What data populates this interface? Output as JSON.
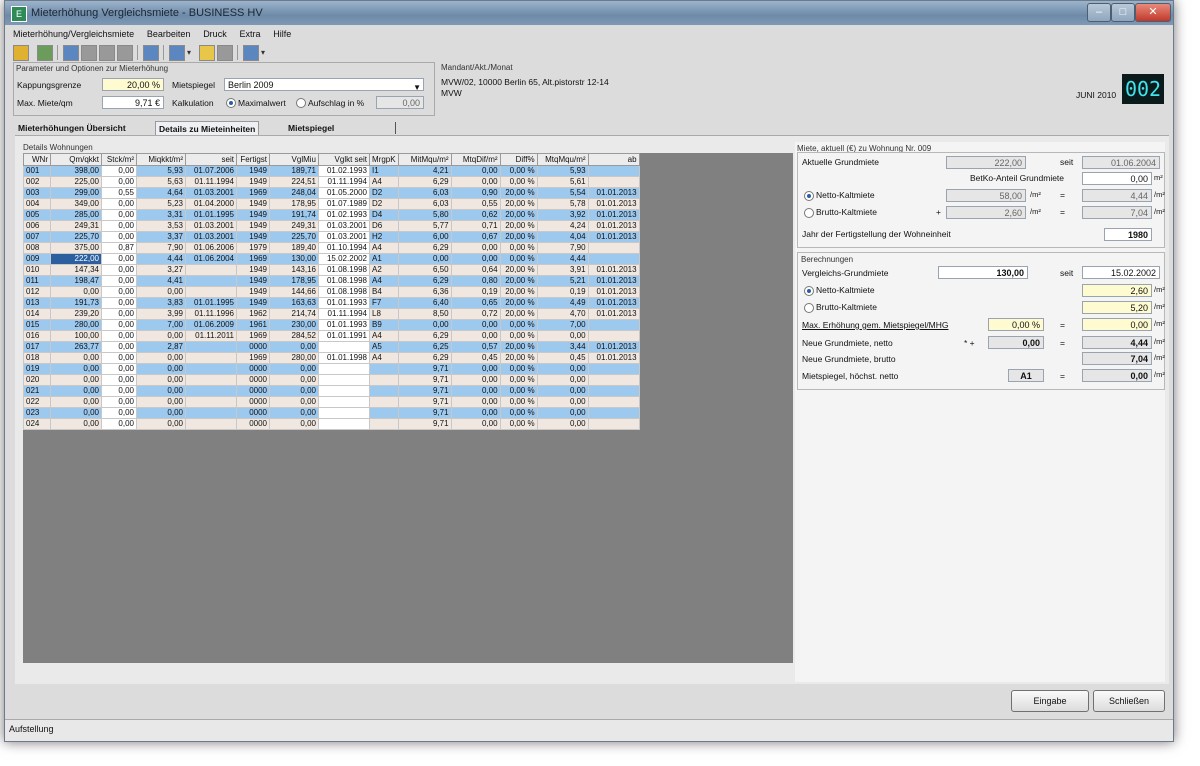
{
  "window": {
    "title": "Mieterhöhung Vergleichsmiete - BUSINESS HV"
  },
  "menu": [
    "Mieterhöhung/Vergleichsmiete",
    "Bearbeiten",
    "Druck",
    "Extra",
    "Hilfe"
  ],
  "params": {
    "group_title": "Parameter und Optionen zur Mieterhöhung",
    "kappung_label": "Kappungsgrenze",
    "kappung_value": "20,00 %",
    "maxmiete_label": "Max. Miete/qm",
    "maxmiete_value": "9,71 €",
    "mietspiegel_label": "Mietspiegel",
    "mietspiegel_value": "Berlin 2009",
    "kalkulation_label": "Kalkulation",
    "maximalwert_label": "Maximalwert",
    "aufschlag_label": "Aufschlag in %",
    "aufschlag_value": "0,00"
  },
  "mandant": {
    "title": "Mandant/Akt./Monat",
    "line1": "MVW/02, 10000 Berlin 65, Alt.pistorstr 12-14",
    "line2": "MVW",
    "month": "JUNI 2010",
    "badge": "002"
  },
  "tabs": [
    "Mieterhöhungen Übersicht",
    "Details zu Mieteinheiten",
    "Mietspiegel"
  ],
  "details": {
    "title": "Details Wohnungen",
    "headers": [
      "WNr",
      "Qm/qkkt",
      "Stck/m²",
      "Miqkkt/m²",
      "seit",
      "Fertigst",
      "VglMiu",
      "Vglkt seit",
      "MrgpK",
      "MitMqu/m²",
      "MtqDif/m²",
      "Diff%",
      "MtqMqu/m²",
      "ab"
    ],
    "rows": [
      {
        "c": [
          "001",
          "398,00",
          "0,00",
          "5,93",
          "01.07.2006",
          "1949",
          "189,71",
          "01.02.1993",
          "I1",
          "4,21",
          "0,00",
          "0,00 %",
          "5,93",
          ""
        ],
        "cls": "blue"
      },
      {
        "c": [
          "002",
          "225,00",
          "0,00",
          "5,63",
          "01.11.1994",
          "1949",
          "224,51",
          "01.11.1994",
          "A4",
          "6,29",
          "0,00",
          "0,00 %",
          "5,61",
          ""
        ],
        "cls": "beige"
      },
      {
        "c": [
          "003",
          "299,00",
          "0,55",
          "4,64",
          "01.03.2001",
          "1969",
          "248,04",
          "01.05.2000",
          "D2",
          "6,03",
          "0,90",
          "20,00 %",
          "5,54",
          "01.01.2013"
        ],
        "cls": "blue"
      },
      {
        "c": [
          "004",
          "349,00",
          "0,00",
          "5,23",
          "01.04.2000",
          "1949",
          "178,95",
          "01.07.1989",
          "D2",
          "6,03",
          "0,55",
          "20,00 %",
          "5,78",
          "01.01.2013"
        ],
        "cls": "beige"
      },
      {
        "c": [
          "005",
          "285,00",
          "0,00",
          "3,31",
          "01.01.1995",
          "1949",
          "191,74",
          "01.02.1993",
          "D4",
          "5,80",
          "0,62",
          "20,00 %",
          "3,92",
          "01.01.2013"
        ],
        "cls": "blue"
      },
      {
        "c": [
          "006",
          "249,31",
          "0,00",
          "3,53",
          "01.03.2001",
          "1949",
          "249,31",
          "01.03.2001",
          "D6",
          "5,77",
          "0,71",
          "20,00 %",
          "4,24",
          "01.01.2013"
        ],
        "cls": "beige"
      },
      {
        "c": [
          "007",
          "225,70",
          "0,00",
          "3,37",
          "01.03.2001",
          "1949",
          "225,70",
          "01.03.2001",
          "H2",
          "6,00",
          "0,67",
          "20,00 %",
          "4,04",
          "01.01.2013"
        ],
        "cls": "blue"
      },
      {
        "c": [
          "008",
          "375,00",
          "0,87",
          "7,90",
          "01.06.2006",
          "1979",
          "189,40",
          "01.10.1994",
          "A4",
          "6,29",
          "0,00",
          "0,00 %",
          "7,90",
          ""
        ],
        "cls": "beige"
      },
      {
        "c": [
          "009",
          "222,00",
          "0,00",
          "4,44",
          "01.06.2004",
          "1969",
          "130,00",
          "15.02.2002",
          "A1",
          "0,00",
          "0,00",
          "0,00 %",
          "4,44",
          ""
        ],
        "cls": "blue"
      },
      {
        "c": [
          "010",
          "147,34",
          "0,00",
          "3,27",
          "",
          "1949",
          "143,16",
          "01.08.1998",
          "A2",
          "6,50",
          "0,64",
          "20,00 %",
          "3,91",
          "01.01.2013"
        ],
        "cls": "beige"
      },
      {
        "c": [
          "011",
          "198,47",
          "0,00",
          "4,41",
          "",
          "1949",
          "178,95",
          "01.08.1998",
          "A4",
          "6,29",
          "0,80",
          "20,00 %",
          "5,21",
          "01.01.2013"
        ],
        "cls": "blue"
      },
      {
        "c": [
          "012",
          "0,00",
          "0,00",
          "0,00",
          "",
          "1949",
          "144,66",
          "01.08.1998",
          "B4",
          "6,36",
          "0,19",
          "20,00 %",
          "0,19",
          "01.01.2013"
        ],
        "cls": "beige"
      },
      {
        "c": [
          "013",
          "191,73",
          "0,00",
          "3,83",
          "01.01.1995",
          "1949",
          "163,63",
          "01.01.1993",
          "F7",
          "6,40",
          "0,65",
          "20,00 %",
          "4,49",
          "01.01.2013"
        ],
        "cls": "blue"
      },
      {
        "c": [
          "014",
          "239,20",
          "0,00",
          "3,99",
          "01.11.1996",
          "1962",
          "214,74",
          "01.11.1994",
          "L8",
          "8,50",
          "0,72",
          "20,00 %",
          "4,70",
          "01.01.2013"
        ],
        "cls": "beige"
      },
      {
        "c": [
          "015",
          "280,00",
          "0,00",
          "7,00",
          "01.06.2009",
          "1961",
          "230,00",
          "01.01.1993",
          "B9",
          "0,00",
          "0,00",
          "0,00 %",
          "7,00",
          ""
        ],
        "cls": "blue"
      },
      {
        "c": [
          "016",
          "100,00",
          "0,00",
          "0,00",
          "01.11.2011",
          "1969",
          "284,52",
          "01.01.1991",
          "A4",
          "6,29",
          "0,00",
          "0,00 %",
          "0,00",
          ""
        ],
        "cls": "beige"
      },
      {
        "c": [
          "017",
          "263,77",
          "0,00",
          "2,87",
          "",
          "0000",
          "0,00",
          "",
          "A5",
          "6,25",
          "0,57",
          "20,00 %",
          "3,44",
          "01.01.2013"
        ],
        "cls": "blue"
      },
      {
        "c": [
          "018",
          "0,00",
          "0,00",
          "0,00",
          "",
          "1969",
          "280,00",
          "01.01.1998",
          "A4",
          "6,29",
          "0,45",
          "20,00 %",
          "0,45",
          "01.01.2013"
        ],
        "cls": "beige"
      },
      {
        "c": [
          "019",
          "0,00",
          "0,00",
          "0,00",
          "",
          "0000",
          "0,00",
          "",
          "",
          "9,71",
          "0,00",
          "0,00 %",
          "0,00",
          ""
        ],
        "cls": "blue"
      },
      {
        "c": [
          "020",
          "0,00",
          "0,00",
          "0,00",
          "",
          "0000",
          "0,00",
          "",
          "",
          "9,71",
          "0,00",
          "0,00 %",
          "0,00",
          ""
        ],
        "cls": "beige"
      },
      {
        "c": [
          "021",
          "0,00",
          "0,00",
          "0,00",
          "",
          "0000",
          "0,00",
          "",
          "",
          "9,71",
          "0,00",
          "0,00 %",
          "0,00",
          ""
        ],
        "cls": "blue"
      },
      {
        "c": [
          "022",
          "0,00",
          "0,00",
          "0,00",
          "",
          "0000",
          "0,00",
          "",
          "",
          "9,71",
          "0,00",
          "0,00 %",
          "0,00",
          ""
        ],
        "cls": "beige"
      },
      {
        "c": [
          "023",
          "0,00",
          "0,00",
          "0,00",
          "",
          "0000",
          "0,00",
          "",
          "",
          "9,71",
          "0,00",
          "0,00 %",
          "0,00",
          ""
        ],
        "cls": "blue"
      },
      {
        "c": [
          "024",
          "0,00",
          "0,00",
          "0,00",
          "",
          "0000",
          "0,00",
          "",
          "",
          "9,71",
          "0,00",
          "0,00 %",
          "0,00",
          ""
        ],
        "cls": "beige"
      }
    ]
  },
  "right": {
    "header": "Miete, aktuell (€) zu Wohnung Nr. 009",
    "akt_label": "Aktuelle Grundmiete",
    "akt_value": "222,00",
    "seit_label": "seit",
    "akt_seit": "01.06.2004",
    "betr_label": "BetKo-Anteil Grundmiete",
    "betr_value": "0,00",
    "netto_kalt_label": "Netto-Kaltmiete",
    "netto_qm": "58,00",
    "netto_per": "4,44",
    "brutto_kalt_label": "Brutto-Kaltmiete",
    "brutto_qm": "2,60",
    "brutto_per": "7,04",
    "fertig_label": "Jahr der Fertigstellung der Wohneinheit",
    "fertig_value": "1980",
    "berechnung_title": "Berechnungen",
    "vgl_label": "Vergleichs-Grundmiete",
    "vgl_value": "130,00",
    "vgl_seit": "15.02.2002",
    "netto2_label": "Netto-Kaltmiete",
    "netto2_value": "2,60",
    "brutto2_label": "Brutto-Kaltmiete",
    "brutto2_value": "5,20",
    "max_label": "Max. Erhöhung gem. Mietspiegel/MHG",
    "max_pct": "0,00 %",
    "max_value": "0,00",
    "neu_netto_label": "Neue Grundmiete, netto",
    "neu_netto_value": "4,44",
    "neu_brutto_label": "Neue Grundmiete, brutto",
    "neu_brutto_value": "7,04",
    "neu_mid_value": "0,00",
    "ms_label": "Mietspiegel, höchst. netto",
    "ms_feld": "A1",
    "ms_value": "0,00"
  },
  "buttons": {
    "eingabe": "Eingabe",
    "schliessen": "Schließen"
  },
  "status": {
    "text": "Aufstellung"
  }
}
